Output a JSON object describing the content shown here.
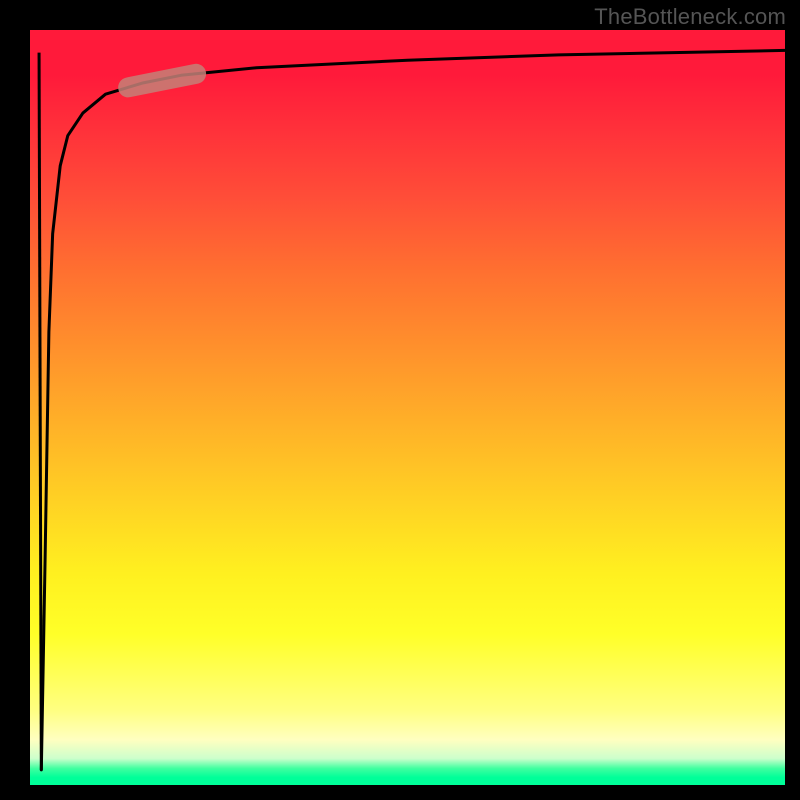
{
  "watermark": "TheBottleneck.com",
  "chart_data": {
    "type": "line",
    "title": "",
    "xlabel": "",
    "ylabel": "",
    "xlim": [
      0,
      100
    ],
    "ylim": [
      0,
      100
    ],
    "grid": false,
    "series": [
      {
        "name": "curve",
        "x": [
          1.5,
          2,
          2.5,
          3,
          4,
          5,
          7,
          10,
          15,
          20,
          30,
          50,
          70,
          100
        ],
        "y": [
          2,
          30,
          60,
          73,
          82,
          86,
          89,
          91.5,
          93,
          94,
          95,
          96,
          96.7,
          97.3
        ]
      }
    ],
    "annotations": [
      {
        "name": "marker-pill",
        "shape": "rounded-segment",
        "x_range": [
          13,
          22
        ],
        "y_approx": 88,
        "color": "#c58178"
      }
    ],
    "colors": {
      "curve_stroke": "#000000",
      "marker_fill": "#c58178",
      "gradient_top": "#ff1a3a",
      "gradient_mid": "#ffff28",
      "gradient_bottom": "#00ff99",
      "background": "#000000",
      "watermark": "#555555"
    }
  }
}
